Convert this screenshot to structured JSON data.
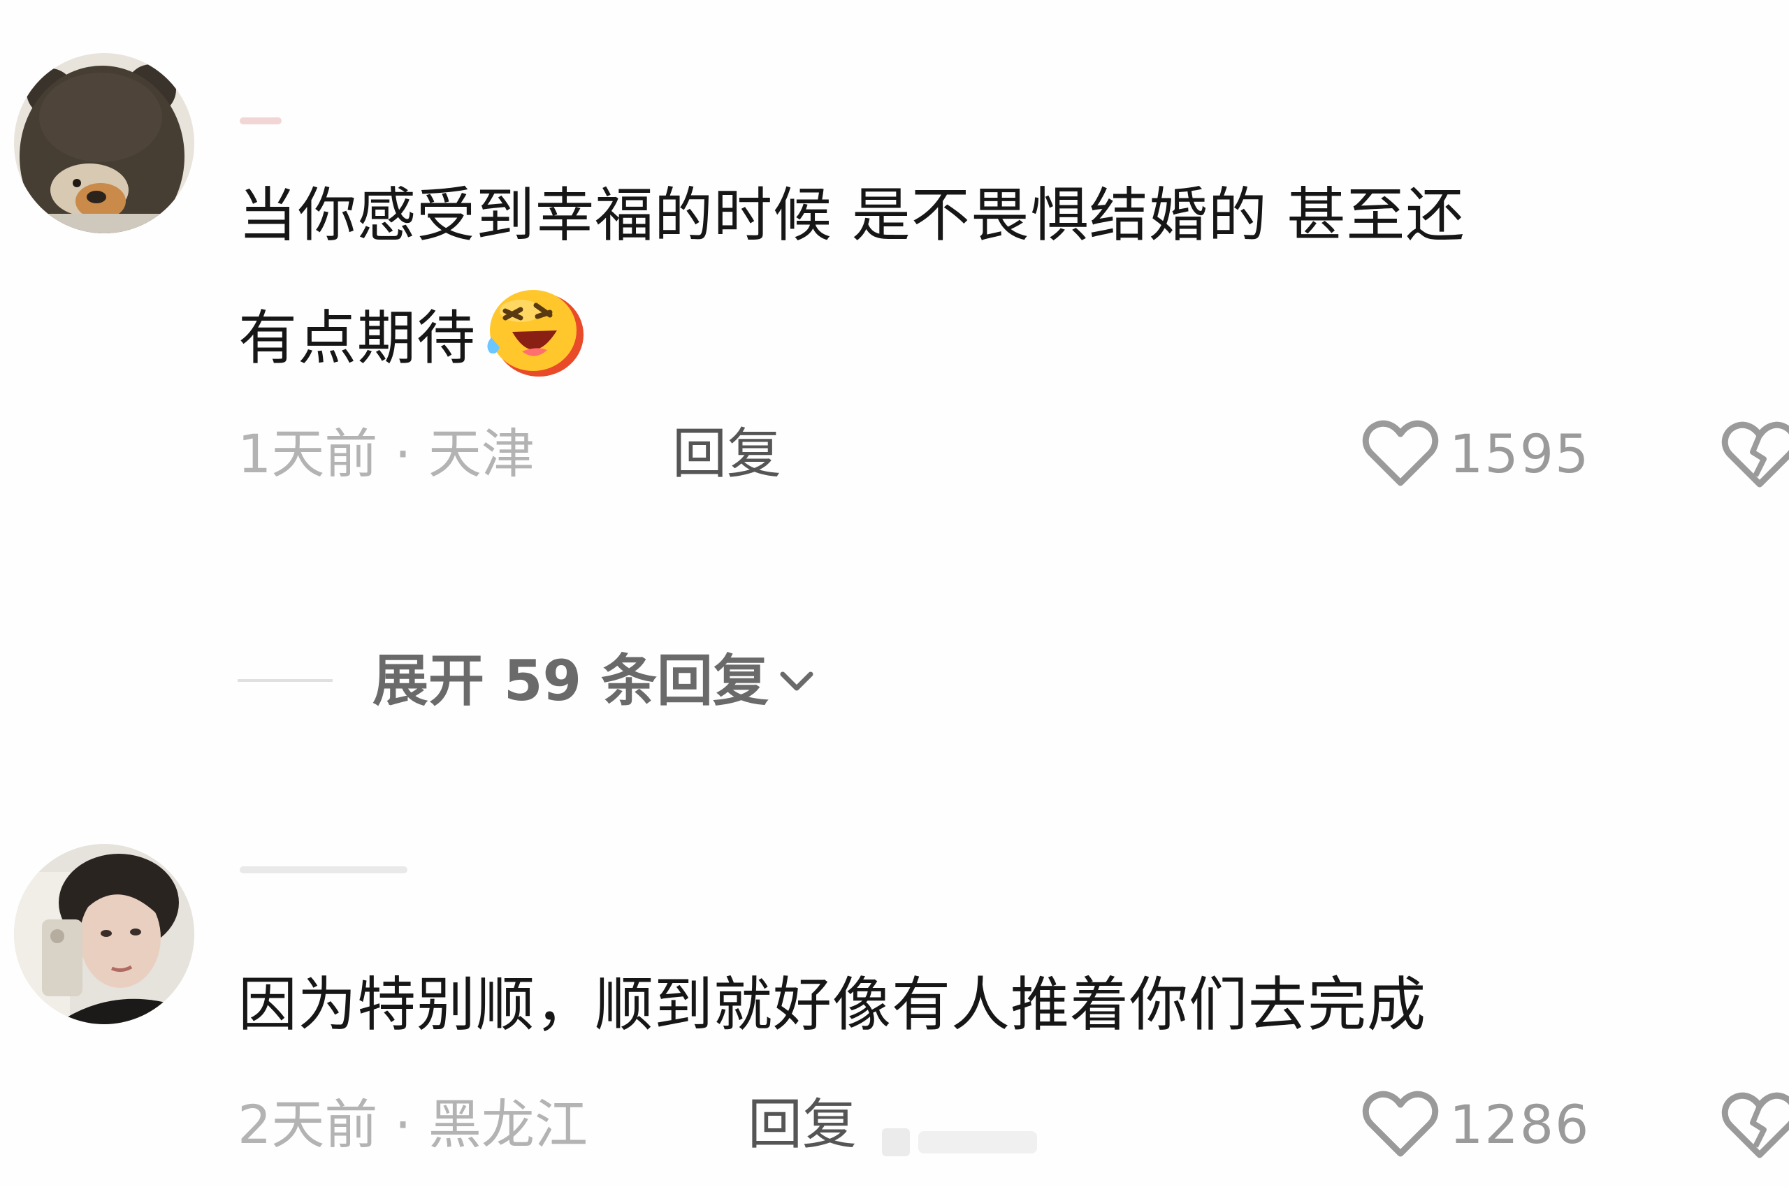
{
  "comments": [
    {
      "text_line1": "当你感受到幸福的时候 是不畏惧结婚的 甚至还",
      "text_line2": "有点期待",
      "meta": "1天前 · 天津",
      "reply_label": "回复",
      "likes": "1595",
      "emoji": "laughing-face-emoji"
    },
    {
      "text_line1": "因为特别顺，顺到就好像有人推着你们去完成",
      "meta": "2天前 · 黑龙江",
      "reply_label": "回复",
      "likes": "1286"
    }
  ],
  "expand_replies": "展开 59 条回复",
  "icons": [
    "heart-outline-icon",
    "broken-heart-icon",
    "chevron-down-icon"
  ],
  "colors": {
    "text": "#161616",
    "meta": "#b3b3b3",
    "reply": "#555555",
    "expand": "#6a6a6a"
  }
}
